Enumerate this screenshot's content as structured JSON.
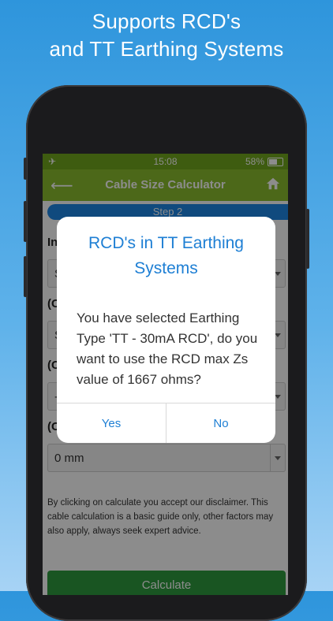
{
  "promo": {
    "headline_line1": "Supports RCD's",
    "headline_line2": "and TT Earthing Systems"
  },
  "status_bar": {
    "time": "15:08",
    "battery": "58%"
  },
  "app_bar": {
    "title": "Cable Size Calculator"
  },
  "step": {
    "label": "Step 2"
  },
  "form": {
    "label1": "In",
    "select1": "S",
    "label2": "(C",
    "select2": "S",
    "label3": "(C",
    "select3": "-",
    "label4": "(C",
    "select4": "0 mm"
  },
  "disclaimer": "By clicking on calculate you accept our disclaimer. This cable calculation is a basic guide only, other factors may also apply, always seek expert advice.",
  "calculate_label": "Calculate",
  "dialog": {
    "title": "RCD's in TT Earthing Systems",
    "message": "You have selected Earthing Type 'TT - 30mA RCD', do you want to use the RCD max Zs value of 1667 ohms?",
    "yes": "Yes",
    "no": "No"
  },
  "colors": {
    "status_green": "#72a81e",
    "header_green": "#8bbd2e",
    "accent_blue": "#1e7fd4",
    "calc_green": "#2e9c3e"
  }
}
